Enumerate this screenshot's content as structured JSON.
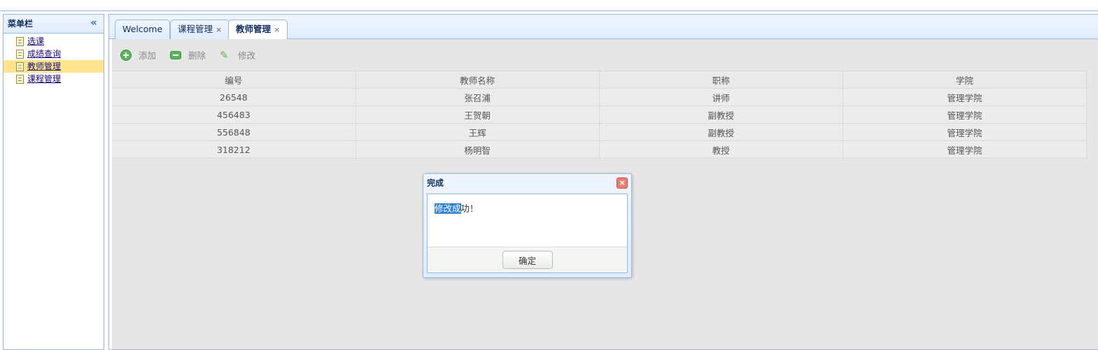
{
  "sidebar": {
    "title": "菜单栏",
    "collapse_glyph": "«",
    "items": [
      {
        "label": "选课",
        "active": false
      },
      {
        "label": "成绩查询",
        "active": false
      },
      {
        "label": "教师管理",
        "active": true
      },
      {
        "label": "课程管理",
        "active": false
      }
    ]
  },
  "tabs": [
    {
      "label": "Welcome",
      "closable": false,
      "selected": false
    },
    {
      "label": "课程管理",
      "closable": true,
      "selected": false
    },
    {
      "label": "教师管理",
      "closable": true,
      "selected": true
    }
  ],
  "tab_close_glyph": "×",
  "toolbar": {
    "add_label": "添加",
    "delete_label": "删除",
    "edit_label": "修改"
  },
  "table": {
    "columns": [
      "编号",
      "教师名称",
      "职称",
      "学院"
    ],
    "rows": [
      [
        "26548",
        "张召浦",
        "讲师",
        "管理学院"
      ],
      [
        "456483",
        "王贺朝",
        "副教授",
        "管理学院"
      ],
      [
        "556848",
        "王辉",
        "副教授",
        "管理学院"
      ],
      [
        "318212",
        "杨明智",
        "教授",
        "管理学院"
      ]
    ]
  },
  "dialog": {
    "title": "完成",
    "message_selected": "修改成",
    "message_rest": "功！",
    "ok_label": "确定",
    "close_glyph": "×"
  }
}
